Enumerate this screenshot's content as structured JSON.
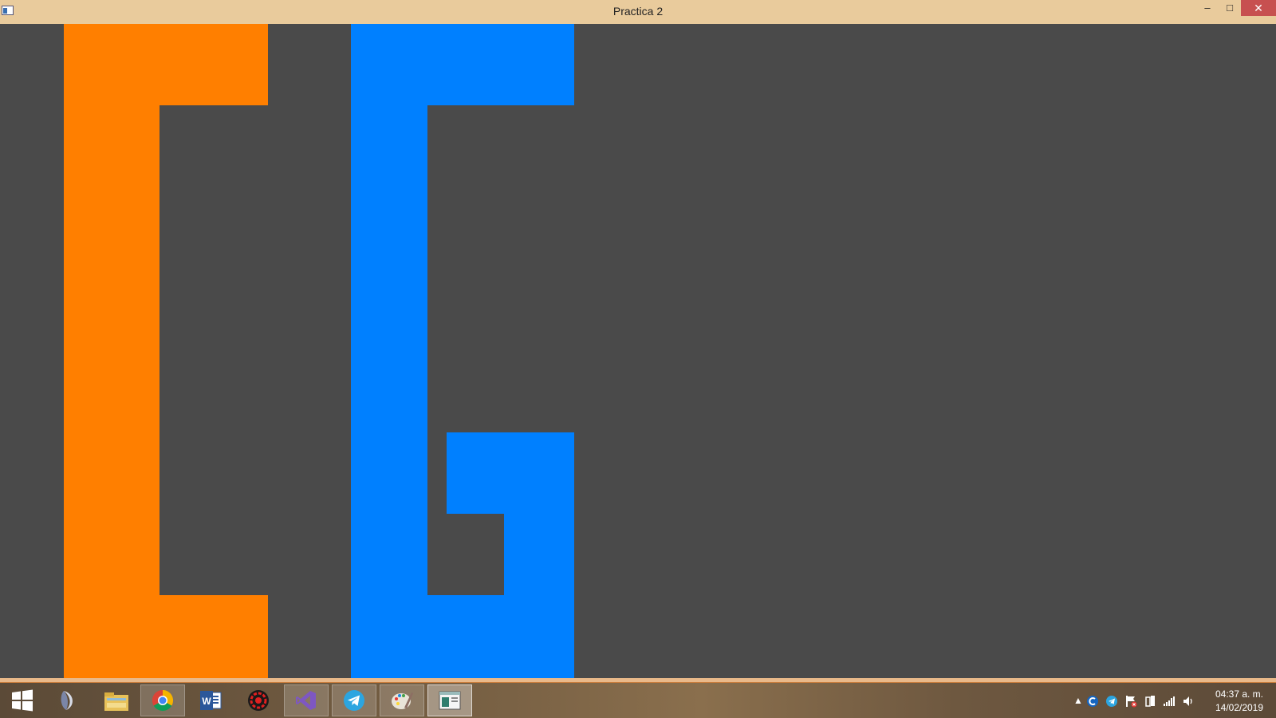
{
  "window": {
    "title": "Practica 2",
    "minimize_glyph": "–",
    "maximize_glyph": "□",
    "close_glyph": "✕"
  },
  "canvas": {
    "background": "#4a4a4a",
    "letter_c_color": "#ff7f00",
    "letter_g_color": "#0080ff"
  },
  "taskbar": {
    "items": [
      {
        "icon": "windows-start-icon"
      },
      {
        "icon": "eclipse-icon"
      },
      {
        "icon": "file-explorer-icon"
      },
      {
        "icon": "chrome-icon"
      },
      {
        "icon": "word-icon"
      },
      {
        "icon": "red-gear-app-icon"
      },
      {
        "icon": "visual-studio-icon"
      },
      {
        "icon": "telegram-icon"
      },
      {
        "icon": "paint-icon"
      },
      {
        "icon": "practica-window-icon"
      }
    ],
    "tray_icons": [
      "show-hidden-icons-arrow",
      "ccleaner-icon",
      "telegram-tray-icon",
      "action-center-flag-icon",
      "power-icon",
      "network-signal-icon",
      "volume-icon"
    ],
    "clock": {
      "time": "04:37 a. m.",
      "date": "14/02/2019"
    }
  }
}
